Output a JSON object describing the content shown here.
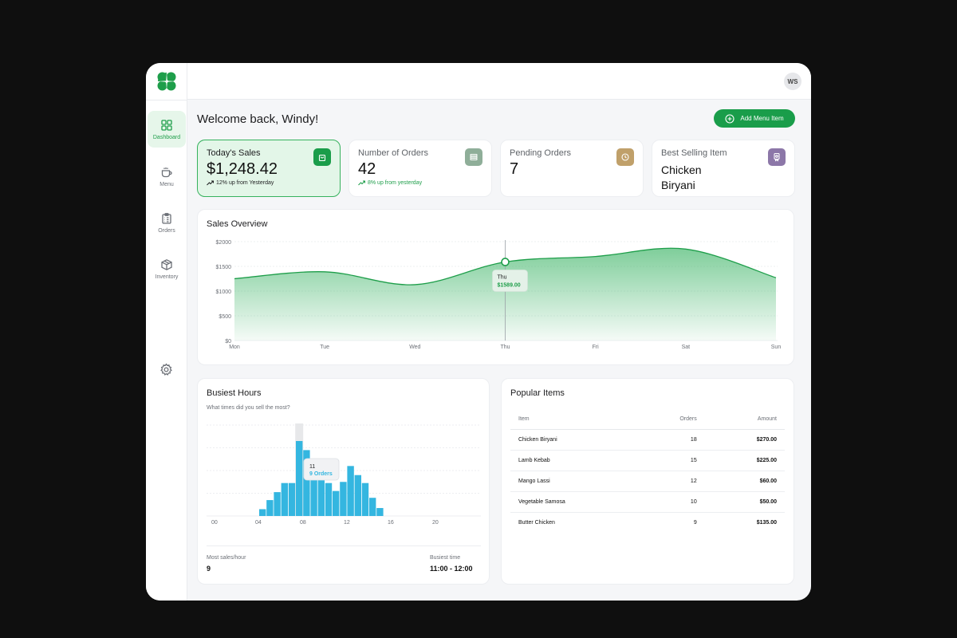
{
  "user": {
    "initials": "WS",
    "welcome": "Welcome back, Windy!"
  },
  "nav": [
    {
      "label": "Dashboard",
      "icon": "grid-icon",
      "active": true
    },
    {
      "label": "Menu",
      "icon": "coffee-cup-icon",
      "active": false
    },
    {
      "label": "Orders",
      "icon": "clipboard-icon",
      "active": false
    },
    {
      "label": "Inventory",
      "icon": "box-icon",
      "active": false
    }
  ],
  "actions": {
    "add_menu_item": "Add Menu Item"
  },
  "stats": [
    {
      "label": "Today's Sales",
      "value": "$1,248.42",
      "sub": "12% up from Yesterday",
      "icon": "shopping-bag-icon",
      "color": "#1a9d4a"
    },
    {
      "label": "Number of Orders",
      "value": "42",
      "sub": "8%  up  from yesterday",
      "icon": "stack-icon",
      "color": "#8fae99"
    },
    {
      "label": "Pending Orders",
      "value": "7",
      "icon": "clock-icon",
      "color": "#c0a06a"
    },
    {
      "label": "Best Selling Item",
      "value_line1": "Chicken",
      "value_line2": "Biryani",
      "icon": "award-icon",
      "color": "#8c77a8"
    }
  ],
  "sales_overview": {
    "title": "Sales Overview",
    "tooltip": {
      "day": "Thu",
      "value": "$1589.00"
    }
  },
  "busiest_hours": {
    "title": "Busiest Hours",
    "subtitle": "What times did you sell the most?",
    "tooltip": {
      "hour": "11",
      "orders": "9 Orders"
    },
    "most_sales_label": "Most sales/hour",
    "most_sales_value": "9",
    "busiest_time_label": "Busiest time",
    "busiest_time_value": "11:00 - 12:00"
  },
  "popular_items": {
    "title": "Popular Items",
    "headers": {
      "item": "Item",
      "orders": "Orders",
      "amount": "Amount"
    },
    "rows": [
      {
        "item": "Chicken Biryani",
        "orders": "18",
        "amount": "$270.00"
      },
      {
        "item": "Lamb Kebab",
        "orders": "15",
        "amount": "$225.00"
      },
      {
        "item": "Mango Lassi",
        "orders": "12",
        "amount": "$60.00"
      },
      {
        "item": "Vegetable Samosa",
        "orders": "10",
        "amount": "$50.00"
      },
      {
        "item": "Butter Chicken",
        "orders": "9",
        "amount": "$135.00"
      }
    ]
  },
  "chart_data": [
    {
      "type": "area",
      "title": "Sales Overview",
      "categories": [
        "Mon",
        "Tue",
        "Wed",
        "Thu",
        "Fri",
        "Sat",
        "Sun"
      ],
      "values": [
        1250,
        1390,
        1130,
        1589,
        1700,
        1850,
        1270
      ],
      "ylim": [
        0,
        2000
      ],
      "yticks": [
        "$0",
        "$500",
        "$1000",
        "$1500",
        "$2000"
      ],
      "grid": true,
      "color": "#1e9e4a"
    },
    {
      "type": "bar",
      "title": "Busiest Hours",
      "x": [
        0,
        1,
        2,
        3,
        4,
        5,
        6,
        7,
        8,
        9,
        10,
        11,
        12,
        13,
        14,
        15,
        16,
        17,
        18,
        19,
        20,
        21,
        22,
        23
      ],
      "xticks": [
        "00",
        "04",
        "08",
        "12",
        "16",
        "20"
      ],
      "values": [
        0,
        0,
        0,
        0,
        0,
        0,
        0.6,
        1.4,
        2.1,
        2.9,
        2.9,
        6.6,
        5.8,
        4.2,
        3.6,
        2.9,
        2.2,
        3.0,
        4.4,
        3.6,
        2.9,
        1.6,
        0.7,
        0
      ],
      "highlight_hour": 11,
      "grid": true,
      "color": "#34b6e0"
    }
  ]
}
